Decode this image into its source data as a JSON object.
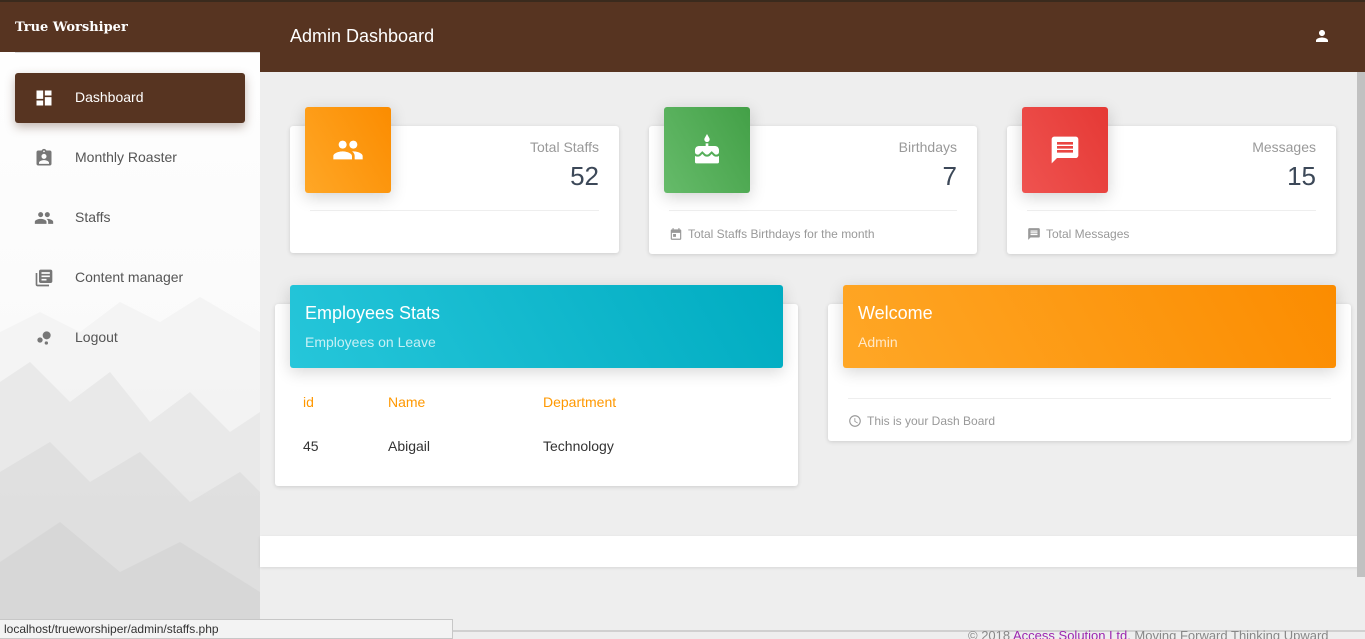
{
  "brand": {
    "name": "True Worshiper"
  },
  "sidebar": {
    "items": [
      {
        "label": "Dashboard",
        "icon": "dashboard-icon",
        "active": true
      },
      {
        "label": "Monthly Roaster",
        "icon": "assignment-ind-icon",
        "active": false
      },
      {
        "label": "Staffs",
        "icon": "people-icon",
        "active": false
      },
      {
        "label": "Content manager",
        "icon": "library-books-icon",
        "active": false
      },
      {
        "label": "Logout",
        "icon": "bubble-chart-icon",
        "active": false
      }
    ]
  },
  "header": {
    "title": "Admin Dashboard",
    "user_icon": "person-icon"
  },
  "stats": [
    {
      "category": "Total Staffs",
      "value": "52",
      "footer": "",
      "icon": "people-icon",
      "color": "#ff9800"
    },
    {
      "category": "Birthdays",
      "value": "7",
      "footer": "Total Staffs Birthdays for the month",
      "footer_icon": "calendar-icon",
      "icon": "cake-icon",
      "color": "#4caf50"
    },
    {
      "category": "Messages",
      "value": "15",
      "footer": "Total Messages",
      "footer_icon": "message-icon",
      "icon": "message-icon",
      "color": "#e53935"
    }
  ],
  "employees": {
    "title": "Employees Stats",
    "subtitle": "Employees on Leave",
    "columns": [
      "id",
      "Name",
      "Department"
    ],
    "rows": [
      [
        "45",
        "Abigail",
        "Technology"
      ]
    ]
  },
  "welcome": {
    "title": "Welcome",
    "subtitle": "Admin",
    "footer": "This is your Dash Board",
    "footer_icon": "clock-icon"
  },
  "status_url": "localhost/trueworshiper/admin/staffs.php",
  "footer": {
    "copyright": "© 2018 ",
    "company": "Access Solution Ltd.",
    "tagline": " Moving Forward Thinking Upward"
  },
  "colors": {
    "primary": "#573421",
    "orange": "#ff9800",
    "green": "#4caf50",
    "red": "#e53935",
    "cyan": "#00acc1"
  }
}
